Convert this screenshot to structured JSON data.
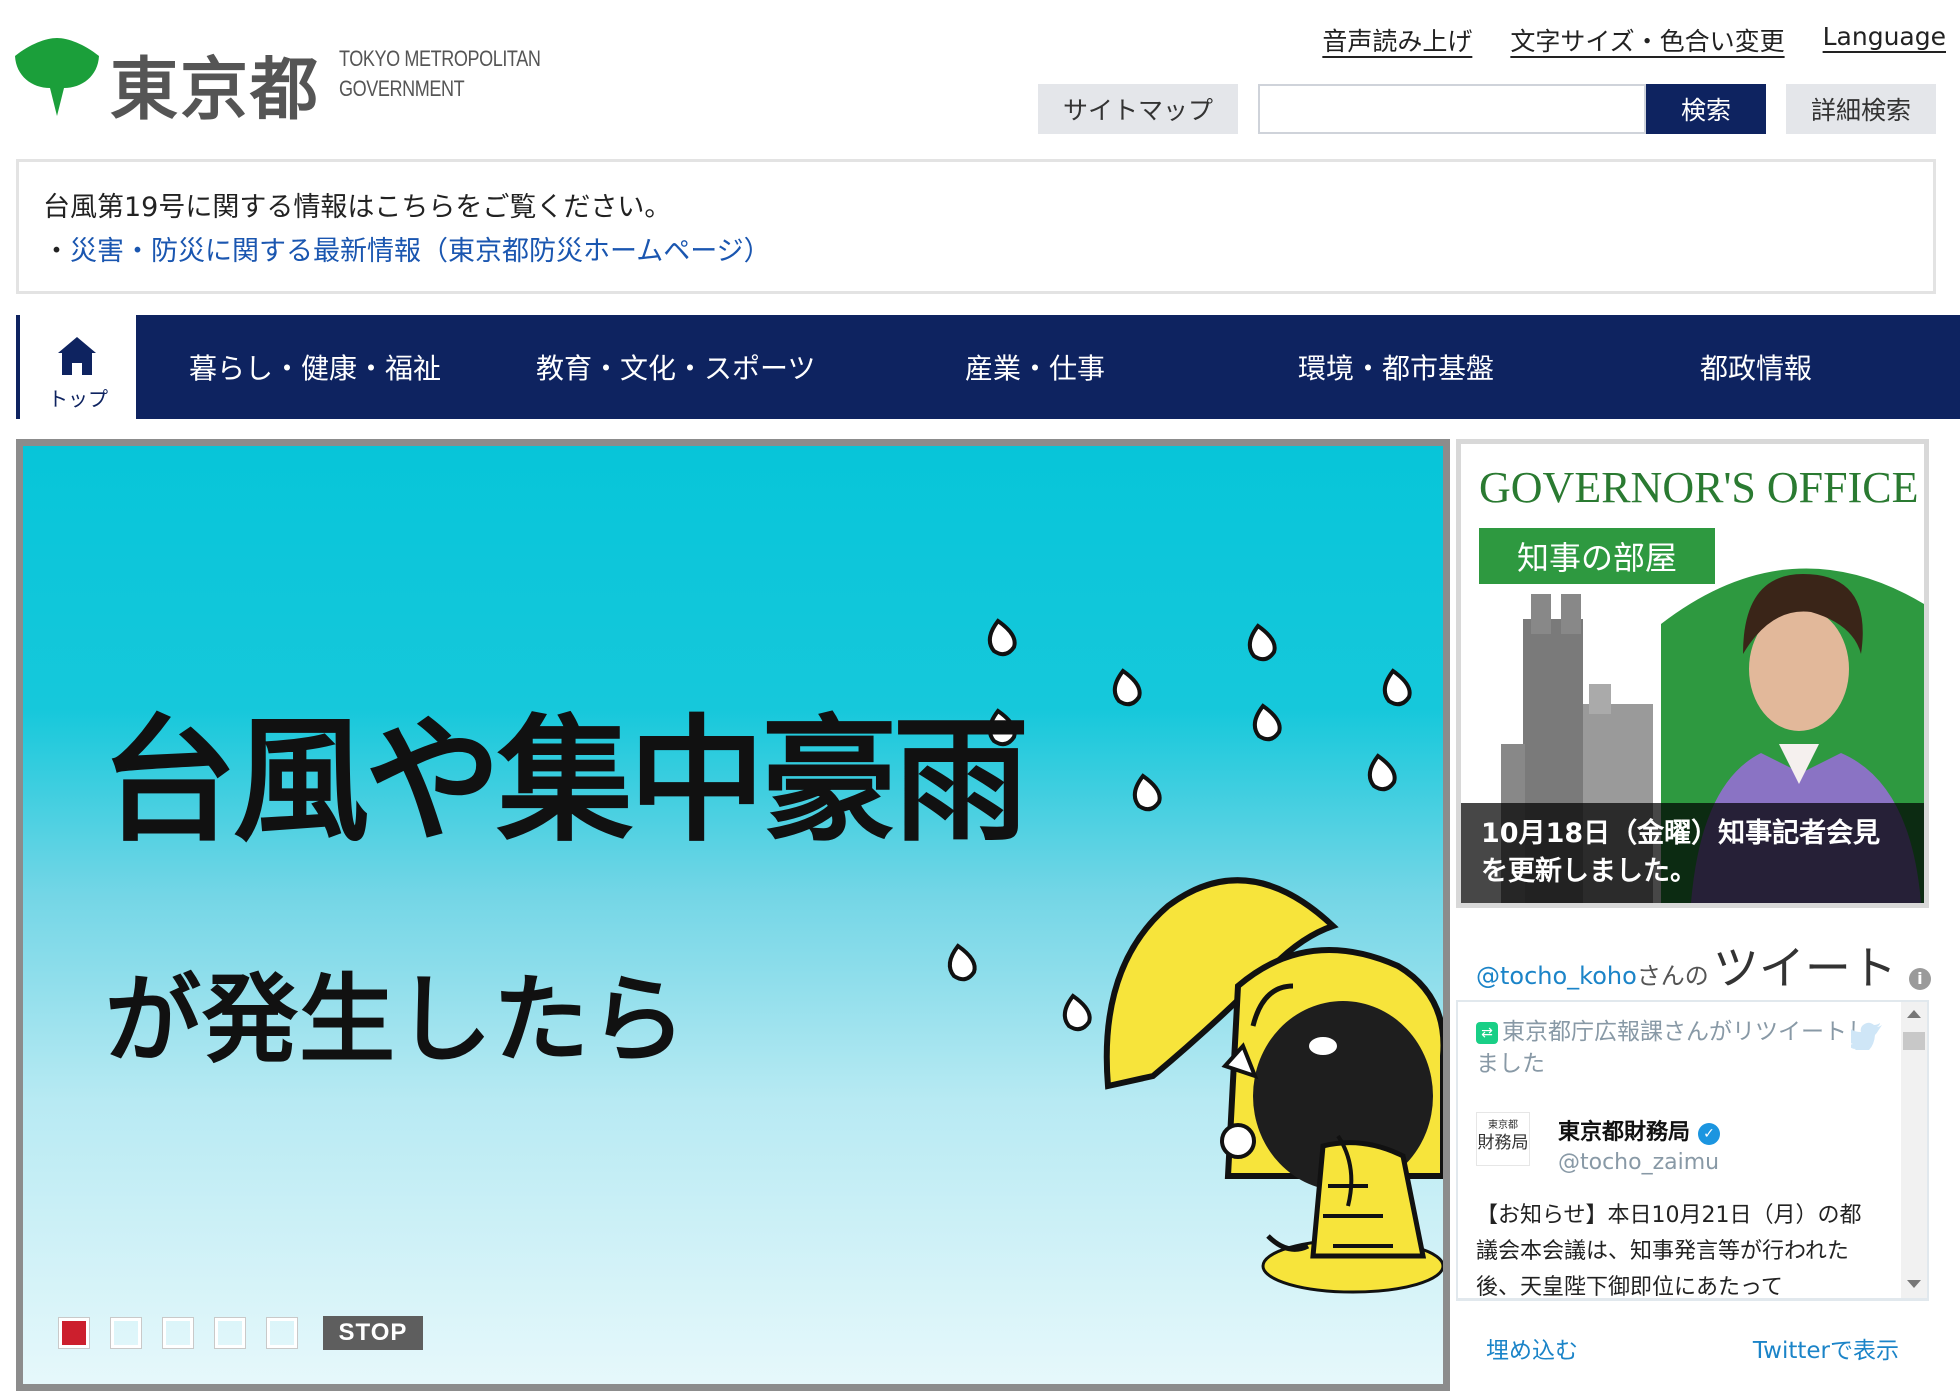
{
  "brand": {
    "name_ja": "東京都",
    "name_en_line1": "TOKYO METROPOLITAN",
    "name_en_line2": "GOVERNMENT",
    "green": "#1b9f3a",
    "navy": "#0e2360"
  },
  "util_links": [
    "音声読み上げ",
    "文字サイズ・色合い変更",
    "Language"
  ],
  "search": {
    "sitemap_label": "サイトマップ",
    "query": "",
    "submit_label": "検索",
    "advanced_label": "詳細検索"
  },
  "notice": {
    "text": "台風第19号に関する情報はこちらをご覧ください。",
    "bullet": "・",
    "link": "災害・防災に関する最新情報（東京都防災ホームページ）"
  },
  "nav": {
    "home_label": "トップ",
    "items": [
      "暮らし・健康・福祉",
      "教育・文化・スポーツ",
      "産業・仕事",
      "環境・都市基盤",
      "都政情報"
    ]
  },
  "slider": {
    "headline_line1": "台風や集中豪雨",
    "headline_line2": "が発生したら",
    "slide_count": 5,
    "active_index": 0,
    "stop_label": "STOP",
    "active_color": "#cc1f2d"
  },
  "governor": {
    "title": "GOVERNOR'S OFFICE",
    "badge": "知事の部屋",
    "caption": "10月18日（金曜）知事記者会見を更新しました。"
  },
  "twitter": {
    "handle": "@tocho_koho",
    "san": "さんの",
    "tweets_label": "ツイート",
    "retweet_note": "東京都庁広報課さんがリツイートしました",
    "author_name": "東京都財務局",
    "author_handle": "@tocho_zaimu",
    "avatar_small": "東京都",
    "avatar_big": "財務局",
    "text": "【お知らせ】本日10月21日（月）の都議会本会議は、知事発言等が行われた後、天皇陛下御即位にあたって",
    "embed_label": "埋め込む",
    "view_label": "Twitterで表示"
  }
}
